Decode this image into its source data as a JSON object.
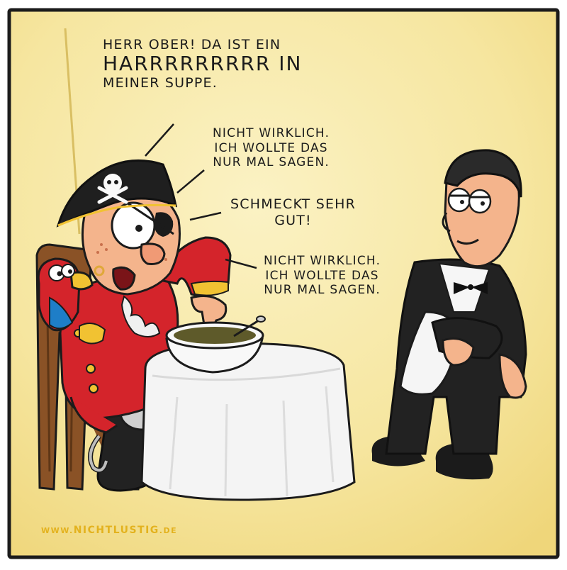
{
  "speech": {
    "bubble1": {
      "line1": "Herr Ober! Da ist ein",
      "line2": "Harrrrrrrrr in",
      "line3": "meiner Suppe."
    },
    "bubble2": {
      "line1": "Nicht wirklich.",
      "line2": "Ich wollte das",
      "line3": "nur mal sagen."
    },
    "bubble3": {
      "line1": "Schmeckt sehr",
      "line2": "gut!"
    },
    "bubble4": {
      "line1": "Nicht wirklich.",
      "line2": "Ich wollte das",
      "line3": "nur mal sagen."
    }
  },
  "credit": {
    "prefix": "www.",
    "name": "nichtlustig",
    "suffix": ".de"
  },
  "colors": {
    "background": "#f7e9a8",
    "pirate_coat": "#d4242b",
    "waiter_suit": "#222222",
    "skin": "#f4b48c",
    "credit_text": "#e3b21e"
  }
}
